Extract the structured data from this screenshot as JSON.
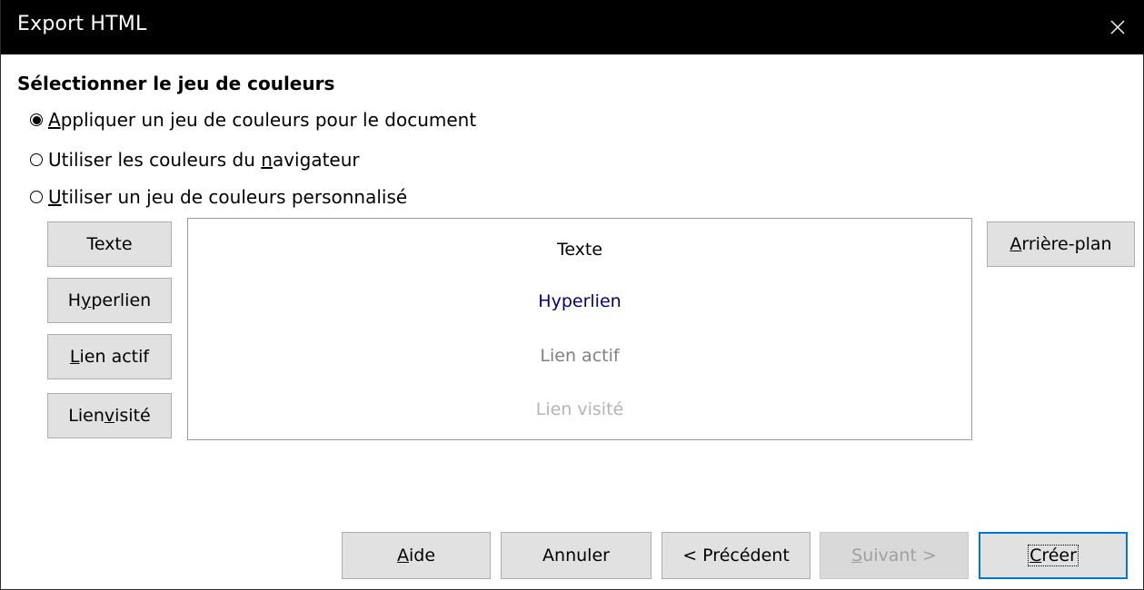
{
  "window": {
    "title": "Export HTML"
  },
  "section": {
    "title": "Sélectionner le jeu de couleurs"
  },
  "radios": [
    {
      "pre": "",
      "mnemonic": "A",
      "post": "ppliquer un jeu de couleurs pour le document",
      "checked": true
    },
    {
      "pre": "Utiliser les couleurs du ",
      "mnemonic": "n",
      "post": "avigateur",
      "checked": false
    },
    {
      "pre": "",
      "mnemonic": "U",
      "post": "tiliser un jeu de couleurs personnalisé",
      "checked": false
    }
  ],
  "color_buttons": {
    "text": {
      "pre": "Texte",
      "mnemonic": "",
      "post": ""
    },
    "hyperlink": {
      "pre": "H",
      "mnemonic": "y",
      "post": "perlien"
    },
    "active_link": {
      "pre": "",
      "mnemonic": "L",
      "post": "ien actif"
    },
    "visited_link": {
      "pre": "Lien ",
      "mnemonic": "v",
      "post": "isité"
    },
    "background": {
      "pre": "",
      "mnemonic": "A",
      "post": "rrière-plan"
    }
  },
  "preview": {
    "text": "Texte",
    "hyperlink": "Hyperlien",
    "active_link": "Lien actif",
    "visited_link": "Lien visité",
    "colors": {
      "text": "#000000",
      "hyperlink": "#000080",
      "active_link": "#808080",
      "visited_link": "#b4b4b4"
    }
  },
  "footer": {
    "help": {
      "pre": "",
      "mnemonic": "A",
      "post": "ide"
    },
    "cancel": {
      "pre": "Annuler",
      "mnemonic": "",
      "post": ""
    },
    "previous": {
      "pre": "< Précédent",
      "mnemonic": "",
      "post": ""
    },
    "next": {
      "pre": "",
      "mnemonic": "S",
      "post": "uivant >"
    },
    "create": {
      "pre": "",
      "mnemonic": "C",
      "post": "réer"
    }
  },
  "colors": {
    "titlebar_bg": "#000000",
    "default_border": "#0078d7"
  }
}
